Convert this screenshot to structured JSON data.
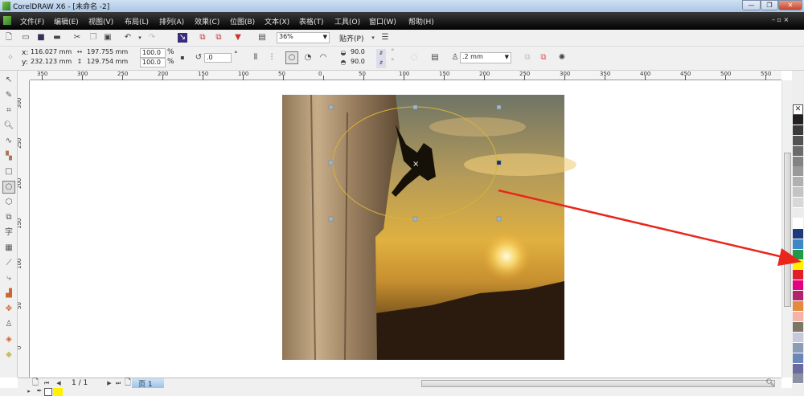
{
  "window": {
    "title": "CorelDRAW X6 - [未命名 -2]",
    "minimize": "—",
    "restore": "❐",
    "close": "✕"
  },
  "menu": [
    "文件(F)",
    "编辑(E)",
    "视图(V)",
    "布局(L)",
    "排列(A)",
    "效果(C)",
    "位图(B)",
    "文本(X)",
    "表格(T)",
    "工具(O)",
    "窗口(W)",
    "帮助(H)"
  ],
  "standard_toolbar": {
    "zoom_level": "36%",
    "snap_label": "贴齐(P)"
  },
  "property_bar": {
    "x_label": "x:",
    "x_value": "116.027 mm",
    "y_label": "y:",
    "y_value": "232.123 mm",
    "width_value": "197.755 mm",
    "height_value": "129.754 mm",
    "scale_x": "100.0",
    "scale_y": "100.0",
    "percent": "%",
    "rotation": ".0",
    "degree": "°",
    "start_angle": "90.0",
    "end_angle": "90.0",
    "outline_width": ".2 mm"
  },
  "rulers": {
    "horizontal": [
      "350",
      "300",
      "250",
      "200",
      "150",
      "100",
      "50",
      "0",
      "50",
      "100",
      "150",
      "200",
      "250",
      "300",
      "350",
      "400",
      "450",
      "500",
      "550"
    ],
    "vertical": [
      "300",
      "250",
      "200",
      "150",
      "100",
      "50",
      "0"
    ],
    "unit": "mm"
  },
  "page_nav": {
    "page_count": "1 / 1",
    "page_tab": "页 1"
  },
  "palette": [
    "none",
    "#231f20",
    "#3b3a3a",
    "#535353",
    "#6b6b6b",
    "#838383",
    "#9a9a9a",
    "#b0b0b0",
    "#c4c4c4",
    "#d8d8d8",
    "#ececec",
    "#ffffff",
    "#1c3a7c",
    "#3e88c8",
    "#1f9a4b",
    "#fff200",
    "#e41e26",
    "#e5007f",
    "#b1246c",
    "#e58a3c",
    "#f5b3a7",
    "#7a7765",
    "#c9c9de",
    "#8c9cb6",
    "#6b86b9",
    "#6a6aa1",
    "#8b91a2"
  ],
  "status": {
    "fill_color": "#fff200"
  },
  "annotation": {
    "arrow_color": "#e8261c"
  },
  "selection": {
    "ellipse_color": "#d9b33a"
  }
}
